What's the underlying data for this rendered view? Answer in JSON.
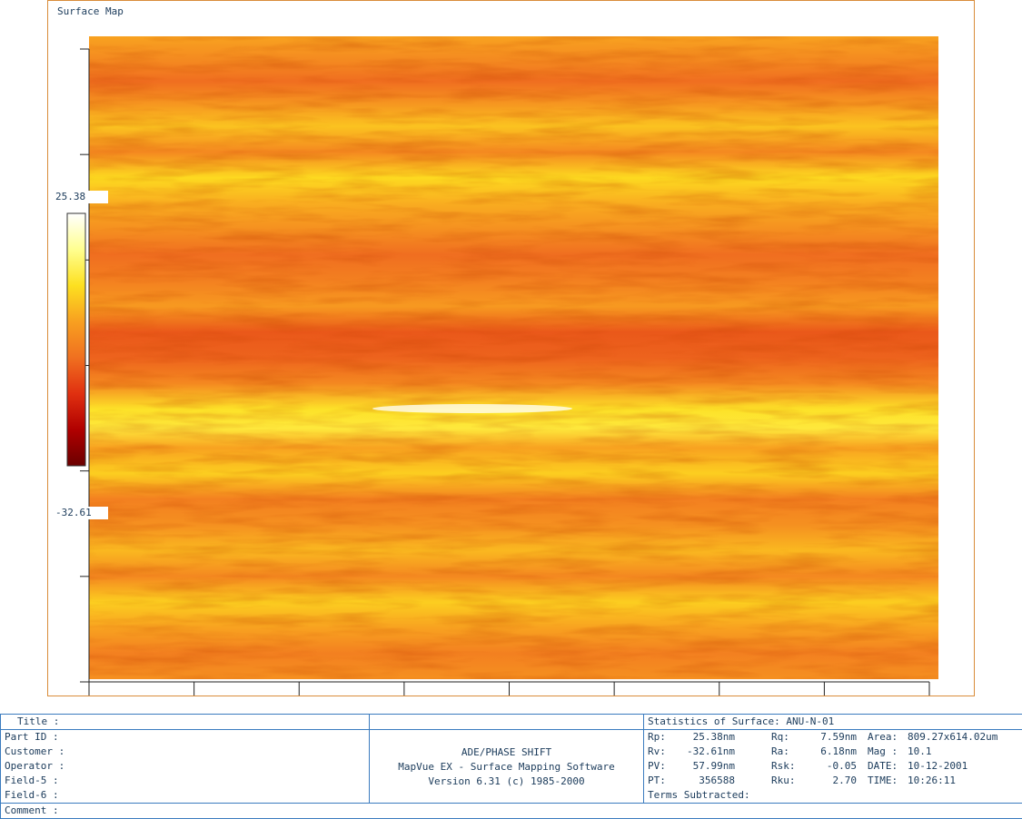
{
  "plot": {
    "title": "Surface Map"
  },
  "chart_data": {
    "type": "heatmap",
    "title": "Surface Map",
    "color_scale": {
      "max": "25.38",
      "min": "-32.61",
      "colors": [
        "#6b0000",
        "#b00000",
        "#e03010",
        "#f07020",
        "#f8a020",
        "#fde020",
        "#ffff90",
        "#ffffff"
      ]
    },
    "grid": false,
    "x_ticks": 9,
    "y_ticks": 7,
    "bands": [
      {
        "y": 0.0,
        "value": 0.55
      },
      {
        "y": 0.04,
        "value": 0.4
      },
      {
        "y": 0.07,
        "value": 0.25
      },
      {
        "y": 0.1,
        "value": 0.45
      },
      {
        "y": 0.14,
        "value": 0.7
      },
      {
        "y": 0.18,
        "value": 0.4
      },
      {
        "y": 0.22,
        "value": 0.8
      },
      {
        "y": 0.26,
        "value": 0.6
      },
      {
        "y": 0.3,
        "value": 0.45
      },
      {
        "y": 0.34,
        "value": 0.25
      },
      {
        "y": 0.38,
        "value": 0.35
      },
      {
        "y": 0.42,
        "value": 0.5
      },
      {
        "y": 0.46,
        "value": 0.15
      },
      {
        "y": 0.5,
        "value": 0.2
      },
      {
        "y": 0.54,
        "value": 0.4
      },
      {
        "y": 0.58,
        "value": 0.85
      },
      {
        "y": 0.61,
        "value": 0.9
      },
      {
        "y": 0.64,
        "value": 0.55
      },
      {
        "y": 0.68,
        "value": 0.75
      },
      {
        "y": 0.72,
        "value": 0.35
      },
      {
        "y": 0.76,
        "value": 0.45
      },
      {
        "y": 0.8,
        "value": 0.65
      },
      {
        "y": 0.84,
        "value": 0.4
      },
      {
        "y": 0.88,
        "value": 0.75
      },
      {
        "y": 0.92,
        "value": 0.55
      },
      {
        "y": 0.96,
        "value": 0.35
      },
      {
        "y": 1.0,
        "value": 0.45
      }
    ]
  },
  "info": {
    "title_label": "Title  :",
    "part_label": "Part ID  :",
    "customer_label": "Customer  :",
    "operator_label": "Operator  :",
    "field5_label": "Field-5  :",
    "field6_label": "Field-6  :",
    "comment_label": "Comment  :",
    "software_line1": "ADE/PHASE SHIFT",
    "software_line2": "MapVue EX - Surface Mapping Software",
    "software_line3": "Version 6.31 (c) 1985-2000",
    "stats_header": "Statistics of Surface:  ANU-N-01",
    "stats": {
      "rp_label": "Rp:",
      "rp_value": "25.38nm",
      "rv_label": "Rv:",
      "rv_value": "-32.61nm",
      "pv_label": "PV:",
      "pv_value": "57.99nm",
      "pt_label": "PT:",
      "pt_value": "356588",
      "rq_label": "Rq:",
      "rq_value": "7.59nm",
      "ra_label": "Ra:",
      "ra_value": "6.18nm",
      "rsk_label": "Rsk:",
      "rsk_value": "-0.05",
      "rku_label": "Rku:",
      "rku_value": "2.70",
      "area_label": "Area:",
      "area_value": "809.27x614.02um",
      "mag_label": "Mag :",
      "mag_value": "10.1",
      "date_label": "DATE:",
      "date_value": "10-12-2001",
      "time_label": "TIME:",
      "time_value": "10:26:11"
    },
    "terms_label": "Terms Subtracted:"
  }
}
